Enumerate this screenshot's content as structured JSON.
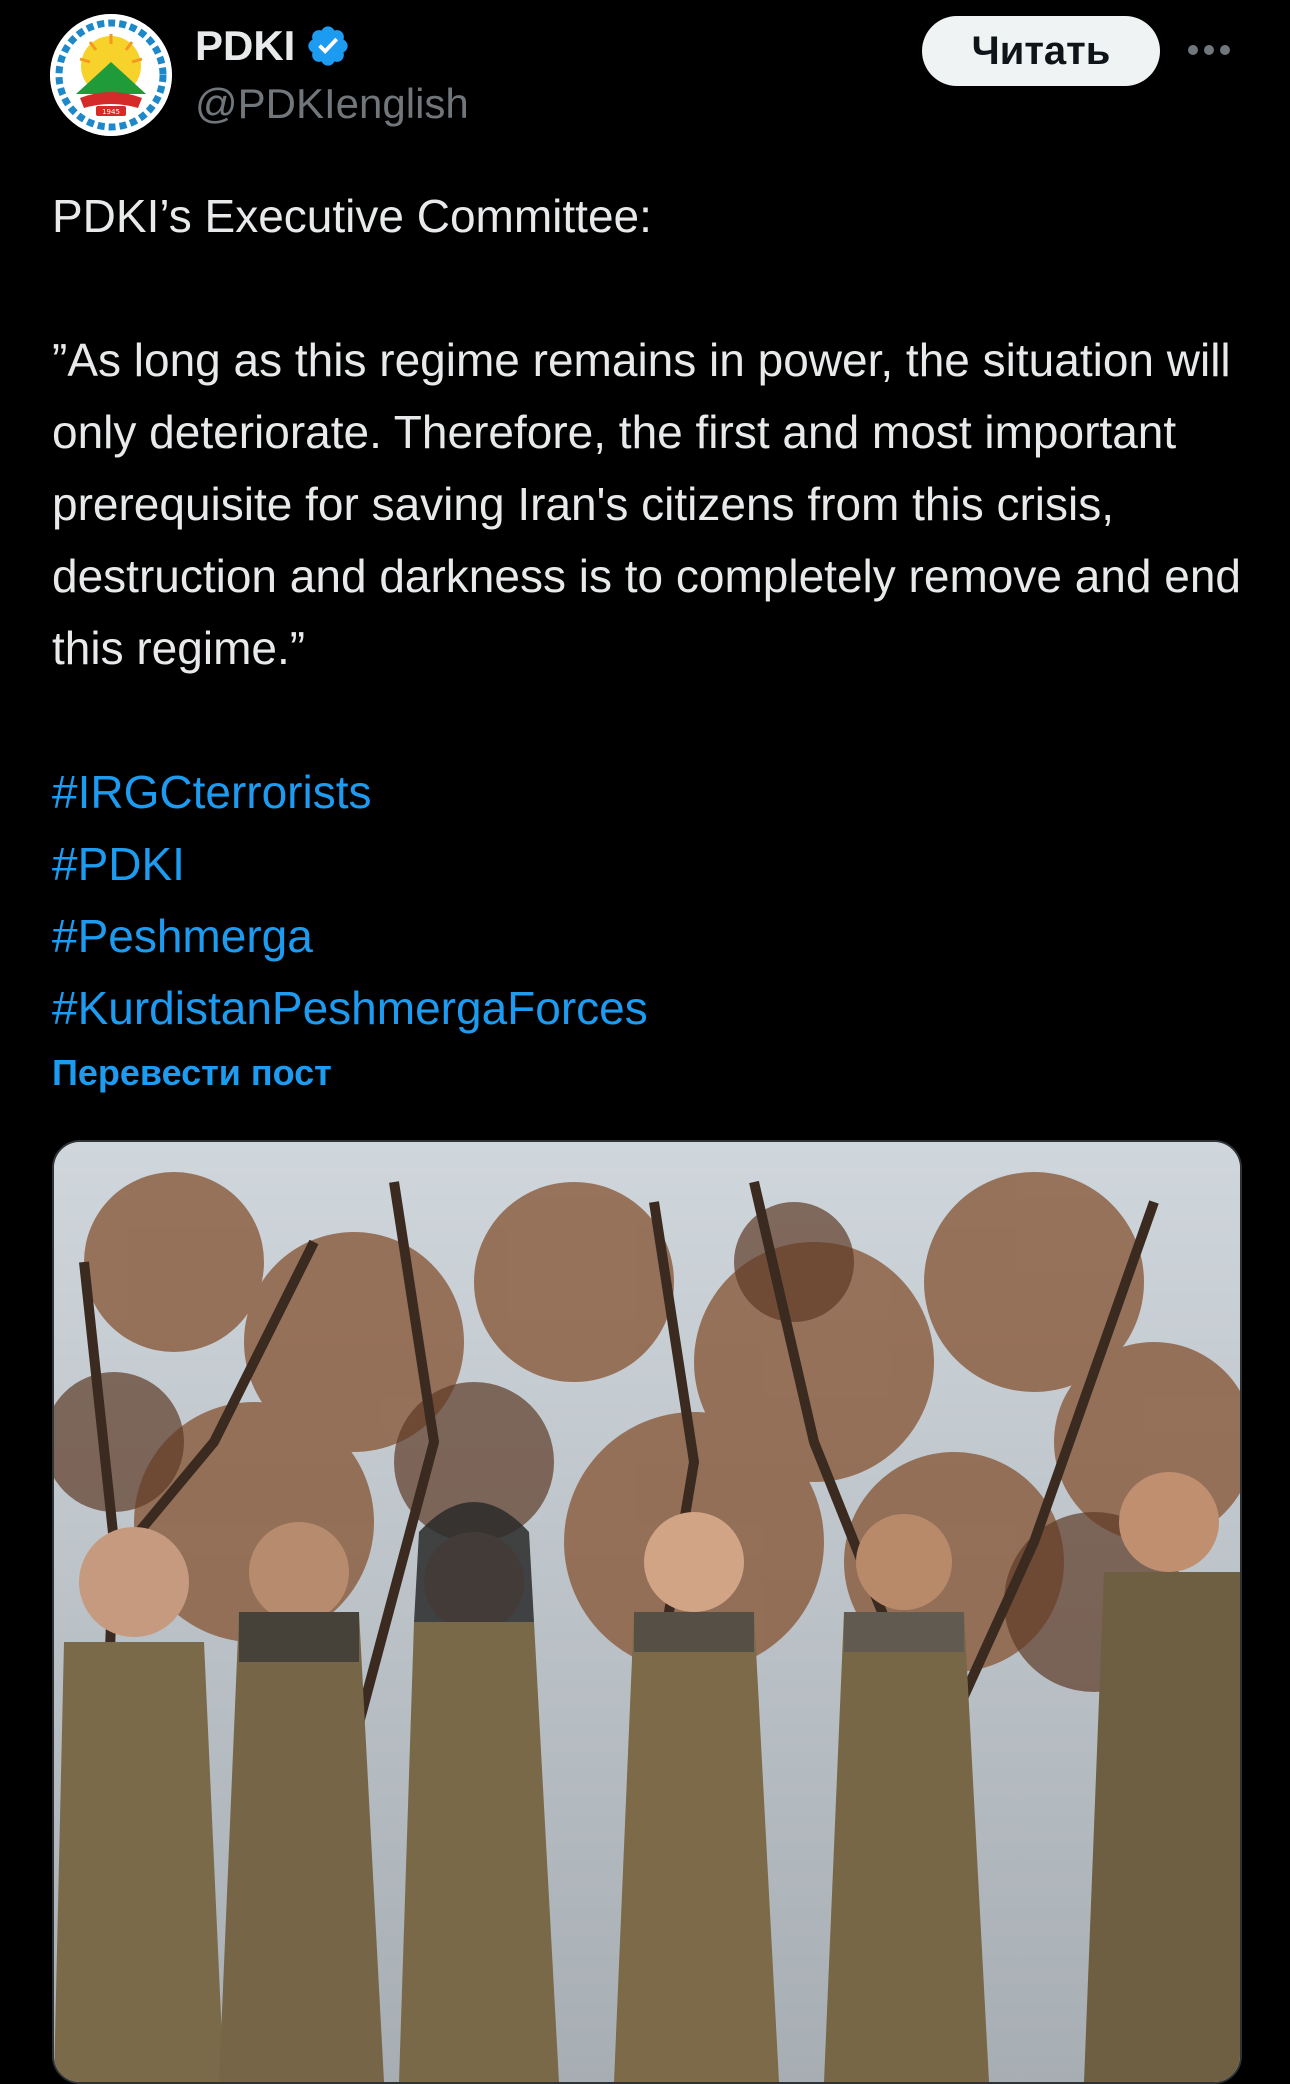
{
  "author": {
    "display_name": "PDKI",
    "handle": "@PDKIenglish",
    "verified": true,
    "avatar_icon": "pdki-logo-icon",
    "avatar_badge_text": "1945"
  },
  "actions": {
    "follow_label": "Читать",
    "more_icon": "more-horizontal-icon"
  },
  "tweet": {
    "line_intro": "PDKI’s Executive Committee:",
    "quote": "”As long as this regime remains in power, the situation will only deteriorate. Therefore, the first and most important prerequisite for saving Iran's citizens from this crisis, destruction and darkness is to completely remove and end this regime.”",
    "hashtags": [
      "#IRGCterrorists",
      "#PDKI",
      "#Peshmerga",
      "#KurdistanPeshmergaForces"
    ],
    "translate_label": "Перевести пост"
  },
  "colors": {
    "background": "#000000",
    "text": "#e7e9ea",
    "secondary_text": "#71767b",
    "link": "#1d9bf0",
    "verified_badge": "#1d9bf0",
    "follow_button_bg": "#eff3f4"
  }
}
